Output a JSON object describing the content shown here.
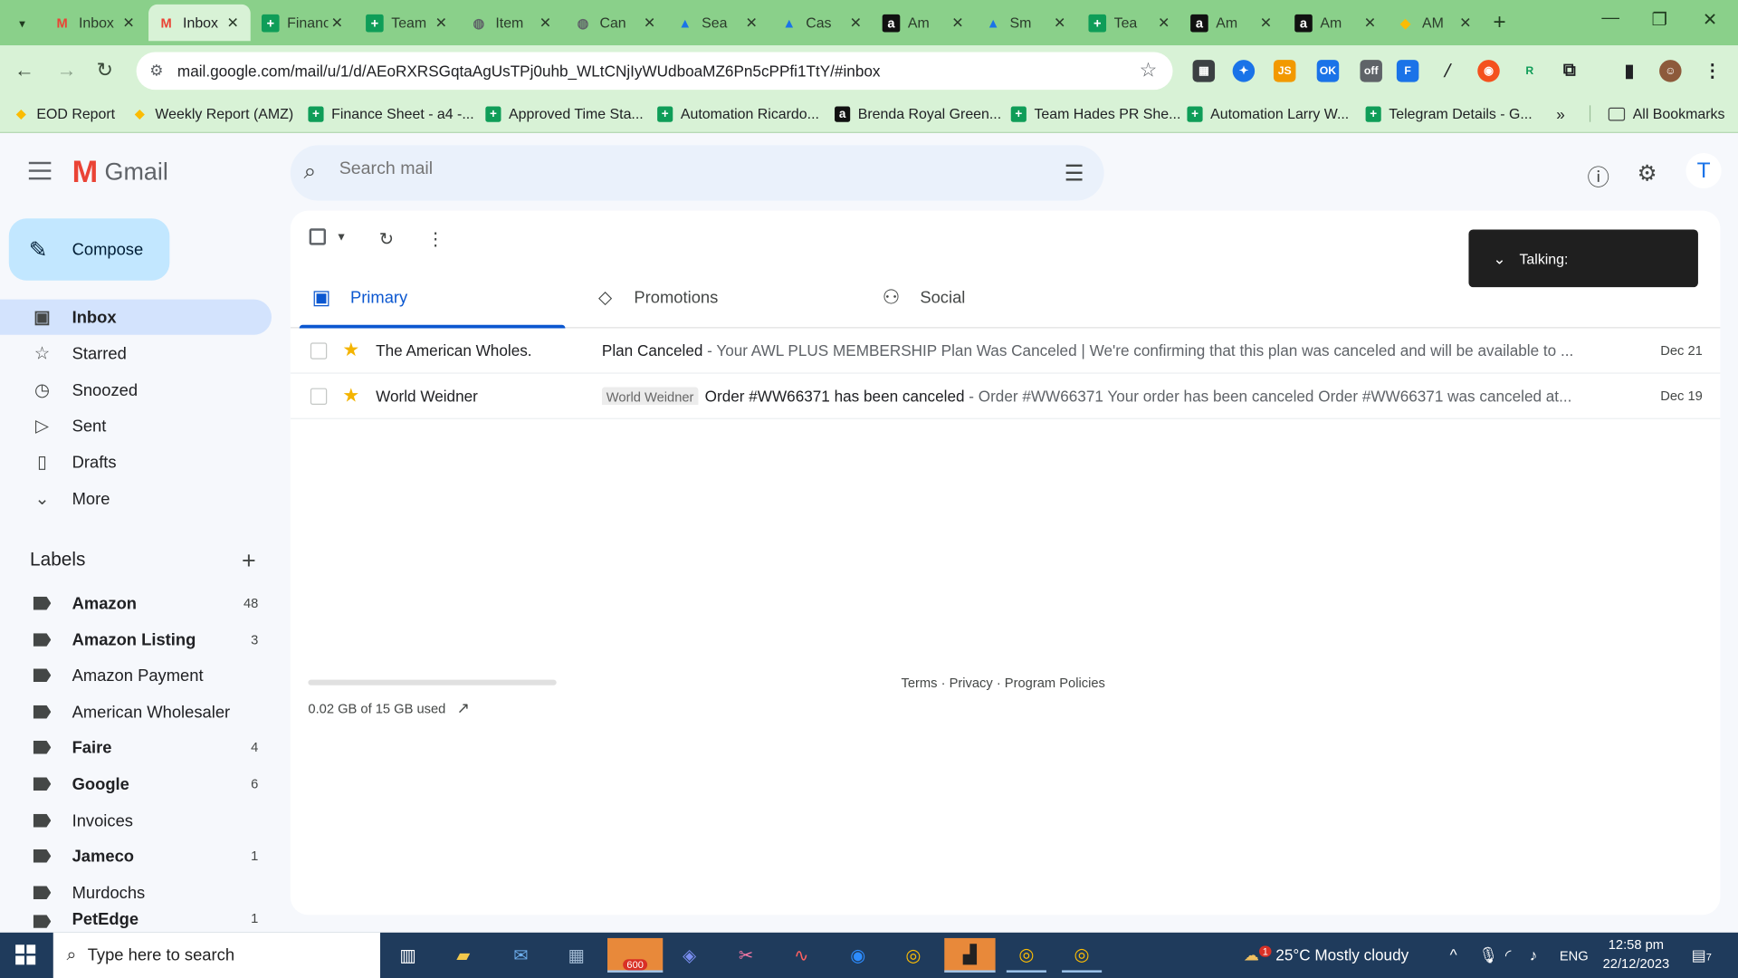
{
  "browser": {
    "tabs": [
      {
        "title": "Inbox",
        "icon": "gmail-icon",
        "color": "#ea4335"
      },
      {
        "title": "Inbox",
        "icon": "gmail-icon",
        "color": "#ea4335",
        "active": true
      },
      {
        "title": "Finance",
        "icon": "sheets-icon",
        "color": "#0f9d58"
      },
      {
        "title": "Team",
        "icon": "sheets-icon",
        "color": "#0f9d58"
      },
      {
        "title": "Item",
        "icon": "globe-icon",
        "color": "#5f6368"
      },
      {
        "title": "Can",
        "icon": "globe-icon",
        "color": "#5f6368"
      },
      {
        "title": "Sea",
        "icon": "seller-icon",
        "color": "#1a73e8"
      },
      {
        "title": "Cas",
        "icon": "seller-icon",
        "color": "#1a73e8"
      },
      {
        "title": "Am",
        "icon": "amazon-icon",
        "color": "#111111"
      },
      {
        "title": "Sm",
        "icon": "seller-icon",
        "color": "#1a73e8"
      },
      {
        "title": "Tea",
        "icon": "sheets-icon",
        "color": "#0f9d58"
      },
      {
        "title": "Am",
        "icon": "amazon-icon",
        "color": "#111111"
      },
      {
        "title": "Am",
        "icon": "amazon-icon",
        "color": "#111111"
      },
      {
        "title": "AM",
        "icon": "ads-icon",
        "color": "#fbbc04"
      }
    ],
    "url": "mail.google.com/mail/u/1/d/AEoRXRSGqtaAgUsTPj0uhb_WLtCNjIyWUdboaMZ6Pn5cPPfi1TtY/#inbox",
    "bookmarks": [
      {
        "label": "EOD Report",
        "icon": "ads-icon",
        "color": "#fbbc04"
      },
      {
        "label": "Weekly Report (AMZ)",
        "icon": "ads-icon",
        "color": "#fbbc04"
      },
      {
        "label": "Finance Sheet - a4 -...",
        "icon": "sheets-icon",
        "color": "#0f9d58"
      },
      {
        "label": "Approved Time Sta...",
        "icon": "sheets-icon",
        "color": "#0f9d58"
      },
      {
        "label": "Automation Ricardo...",
        "icon": "sheets-icon",
        "color": "#0f9d58"
      },
      {
        "label": "Brenda Royal Green...",
        "icon": "amazon-icon",
        "color": "#111111"
      },
      {
        "label": "Team Hades PR She...",
        "icon": "sheets-icon",
        "color": "#0f9d58"
      },
      {
        "label": "Automation Larry W...",
        "icon": "sheets-icon",
        "color": "#0f9d58"
      },
      {
        "label": "Telegram Details - G...",
        "icon": "sheets-icon",
        "color": "#0f9d58"
      }
    ],
    "all_bookmarks": "All Bookmarks"
  },
  "gmail": {
    "brand": "Gmail",
    "search_placeholder": "Search mail",
    "avatar_letter": "T",
    "compose": "Compose",
    "nav": [
      {
        "label": "Inbox",
        "icon": "inbox-icon",
        "active": true
      },
      {
        "label": "Starred",
        "icon": "star-icon"
      },
      {
        "label": "Snoozed",
        "icon": "clock-icon"
      },
      {
        "label": "Sent",
        "icon": "send-icon"
      },
      {
        "label": "Drafts",
        "icon": "draft-icon"
      },
      {
        "label": "More",
        "icon": "chevron-down-icon"
      }
    ],
    "labels_title": "Labels",
    "labels": [
      {
        "name": "Amazon",
        "count": "48",
        "bold": true
      },
      {
        "name": "Amazon Listing",
        "count": "3",
        "bold": true
      },
      {
        "name": "Amazon Payment",
        "count": ""
      },
      {
        "name": "American Wholesaler",
        "count": ""
      },
      {
        "name": "Faire",
        "count": "4",
        "bold": true
      },
      {
        "name": "Google",
        "count": "6",
        "bold": true
      },
      {
        "name": "Invoices",
        "count": ""
      },
      {
        "name": "Jameco",
        "count": "1",
        "bold": true
      },
      {
        "name": "Murdochs",
        "count": ""
      },
      {
        "name": "PetEdge",
        "count": "1",
        "bold": true
      }
    ],
    "tabs": [
      {
        "label": "Primary",
        "icon": "inbox-icon",
        "active": true
      },
      {
        "label": "Promotions",
        "icon": "tag-icon"
      },
      {
        "label": "Social",
        "icon": "people-icon"
      }
    ],
    "emails": [
      {
        "sender": "The American Wholes.",
        "tag": "",
        "subject": "Plan Canceled",
        "snippet": " - Your AWL PLUS MEMBERSHIP Plan Was Canceled | We're confirming that this plan was canceled and will be available to ...",
        "date": "Dec 21"
      },
      {
        "sender": "World Weidner",
        "tag": "World Weidner",
        "subject": "Order #WW66371 has been canceled",
        "snippet": " - Order #WW66371 Your order has been canceled Order #WW66371 was canceled at...",
        "date": "Dec 19"
      }
    ],
    "storage": "0.02 GB of 15 GB used",
    "storage_fraction": 0.0013,
    "footer": "Terms · Privacy · Program Policies",
    "talking": "Talking:"
  },
  "taskbar": {
    "search_placeholder": "Type here to search",
    "telegram_badge": "600",
    "weather": "25°C  Mostly cloudy",
    "weather_badge": "1",
    "lang": "ENG",
    "time": "12:58 pm",
    "date": "22/12/2023",
    "notif_count": "7"
  }
}
